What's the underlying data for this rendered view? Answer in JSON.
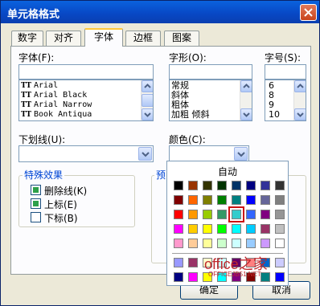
{
  "window": {
    "title": "单元格格式",
    "close_icon": "close-icon"
  },
  "tabs": [
    {
      "label": "数字",
      "active": false
    },
    {
      "label": "对齐",
      "active": false
    },
    {
      "label": "字体",
      "active": true
    },
    {
      "label": "边框",
      "active": false
    },
    {
      "label": "图案",
      "active": false
    }
  ],
  "font": {
    "font_label": "字体(F):",
    "font_value": "",
    "font_list": [
      "Arial",
      "Arial Black",
      "Arial Narrow",
      "Book Antiqua"
    ],
    "style_label": "字形(O):",
    "style_value": "",
    "style_list": [
      "常规",
      "斜体",
      "粗体",
      "加粗 倾斜"
    ],
    "size_label": "字号(S):",
    "size_value": "",
    "size_list": [
      "6",
      "8",
      "9",
      "10"
    ],
    "underline_label": "下划线(U):",
    "underline_value": "",
    "color_label": "颜色(C):",
    "effects_title": "特殊效果",
    "strikethrough_label": "删除线(K)",
    "superscript_label": "上标(E)",
    "subscript_label": "下标(B)",
    "preview_title": "预览"
  },
  "color_palette": {
    "auto_label": "自动",
    "rows": [
      [
        "#000000",
        "#993300",
        "#333300",
        "#003300",
        "#003366",
        "#000080",
        "#333399",
        "#333333"
      ],
      [
        "#800000",
        "#FF6600",
        "#808000",
        "#008000",
        "#008080",
        "#0000FF",
        "#666699",
        "#808080"
      ],
      [
        "#FF0000",
        "#FF9900",
        "#99CC00",
        "#339966",
        "#33CCCC",
        "#3366FF",
        "#800080",
        "#969696"
      ],
      [
        "#FF00FF",
        "#FFCC00",
        "#FFFF00",
        "#00FF00",
        "#00FFFF",
        "#00CCFF",
        "#993366",
        "#C0C0C0"
      ],
      [
        "#FF99CC",
        "#FFCC99",
        "#FFFF99",
        "#CCFFCC",
        "#CCFFFF",
        "#99CCFF",
        "#CC99FF",
        "#FFFFFF"
      ]
    ],
    "extra_rows": [
      [
        "#9999FF",
        "#993366",
        "#FFFFCC",
        "#CCFFFF",
        "#660066",
        "#FF8080",
        "#0066CC",
        "#CCCCFF"
      ],
      [
        "#000080",
        "#FF00FF",
        "#FFFF00",
        "#00FFFF",
        "#800080",
        "#800000",
        "#008080",
        "#0000FF"
      ]
    ],
    "selected_color": "#FFFFFF"
  },
  "buttons": {
    "ok": "确定",
    "cancel": "取消"
  },
  "watermark": {
    "main": "office之家",
    "sub": "OFFICEJB51.NET"
  }
}
